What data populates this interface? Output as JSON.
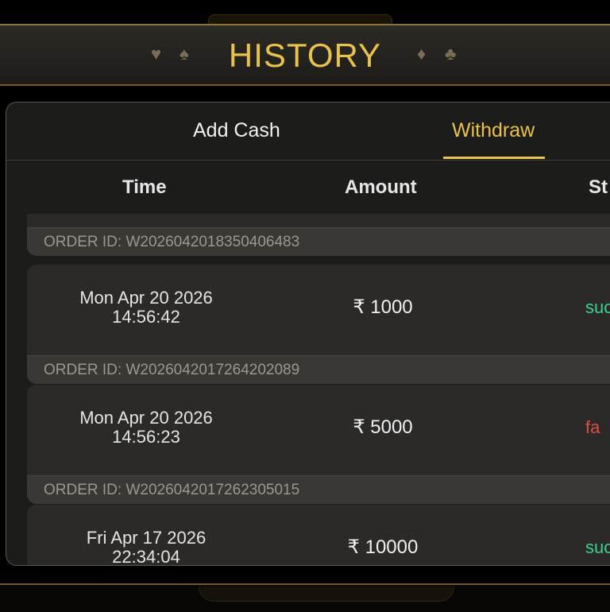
{
  "header": {
    "title": "HISTORY",
    "suits": [
      "♥",
      "♠",
      "♦",
      "♣"
    ]
  },
  "tabs": [
    {
      "label": "Add Cash",
      "active": false
    },
    {
      "label": "Withdraw",
      "active": true
    }
  ],
  "columns": {
    "time": "Time",
    "amount": "Amount",
    "status": "St"
  },
  "top_order": {
    "order_id": "ORDER ID: W2026042018350406483"
  },
  "records": [
    {
      "date": "Mon Apr 20 2026",
      "time": "14:56:42",
      "amount": "₹ 1000",
      "status": "suc",
      "status_type": "success",
      "order_id": "ORDER ID: W2026042017264202089"
    },
    {
      "date": "Mon Apr 20 2026",
      "time": "14:56:23",
      "amount": "₹ 5000",
      "status": "fa",
      "status_type": "failed",
      "order_id": "ORDER ID: W2026042017262305015"
    },
    {
      "date": "Fri Apr 17 2026",
      "time": "22:34:04",
      "amount": "₹ 10000",
      "status": "suc",
      "status_type": "success"
    }
  ],
  "colors": {
    "gold": "#e8c24a",
    "success": "#3ccf8e",
    "failed": "#e64a3f"
  }
}
